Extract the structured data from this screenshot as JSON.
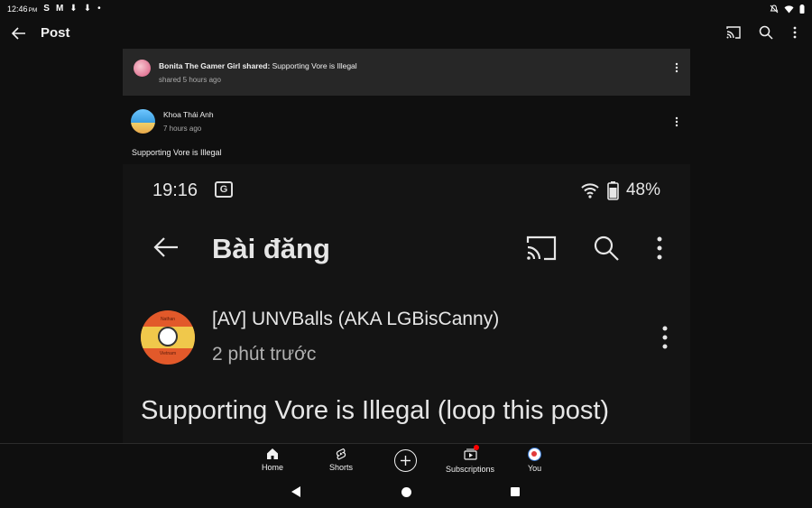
{
  "status_bar": {
    "time": "12:46",
    "time_suffix": "PM",
    "notif_icons": [
      "S",
      "M",
      "⬇",
      "⬇",
      "•"
    ]
  },
  "app_bar": {
    "title": "Post"
  },
  "shared": {
    "sharer": "Bonita The Gamer Girl shared:",
    "shared_title": " Supporting Vore is Illegal",
    "ago": "shared 5 hours ago"
  },
  "post": {
    "author": "Khoa Thái Anh",
    "ago": "7 hours ago",
    "text": "Supporting Vore is Illegal"
  },
  "embedded_screenshot": {
    "time": "19:16",
    "translate_glyph": "G",
    "battery": "48%",
    "page_title": "Bài đăng",
    "avatar_caption_top": "Nathan",
    "avatar_caption_bottom": "Vietnam",
    "channel": "[AV] UNVBalls (AKA LGBisCanny)",
    "ago": "2 phút trước",
    "caption": "Supporting Vore is Illegal (loop this post)"
  },
  "bottom_nav": {
    "home": "Home",
    "shorts": "Shorts",
    "subscriptions": "Subscriptions",
    "you": "You"
  },
  "colors": {
    "background": "#0f0f0f",
    "banner": "#272727",
    "badge": "#ff0000"
  }
}
